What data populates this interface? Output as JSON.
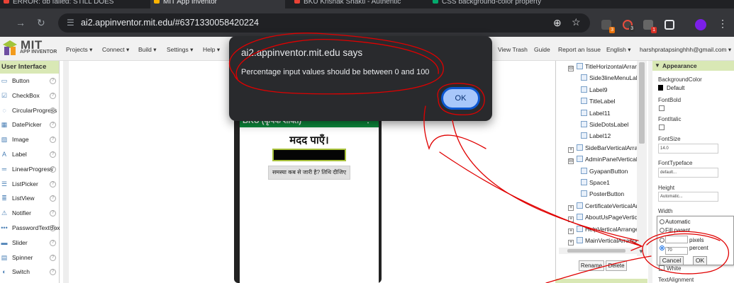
{
  "browser": {
    "tabs": [
      {
        "label": "ERROR: db failed:  STILL DOES",
        "color": "#e94235"
      },
      {
        "label": "MIT App Inventor",
        "color": "#ffb300"
      },
      {
        "label": "BKU Krishak Shakti - Authentic",
        "color": "#e94235"
      },
      {
        "label": "CSS background-color property",
        "color": "#04aa6d"
      }
    ],
    "url": "ai2.appinventor.mit.edu/#6371330058420224",
    "extensions": [
      {
        "name": "puzzle-ext-icon",
        "badge": "3",
        "color": "#ffffff"
      },
      {
        "name": "c-ext-icon",
        "badge": "3",
        "color": "#e84c3d"
      },
      {
        "name": "screen-ext-icon",
        "badge": "1",
        "color": "#bdbdbd"
      },
      {
        "name": "puzzle-piece-icon",
        "badge": "",
        "color": "#e8eaed"
      }
    ]
  },
  "ai_header": {
    "logo_main": "MIT",
    "logo_sub": "APP INVENTOR",
    "menus": [
      "Projects ▾",
      "Connect ▾",
      "Build ▾",
      "Settings ▾",
      "Help ▾"
    ],
    "right_links": [
      "View Trash",
      "Guide",
      "Report an Issue",
      "English ▾",
      "harshpratapsinghhh@gmail.com ▾"
    ]
  },
  "palette": {
    "title": "User Interface",
    "items": [
      {
        "label": "Button",
        "icon": "▭"
      },
      {
        "label": "CheckBox",
        "icon": "☑"
      },
      {
        "label": "CircularProgress",
        "icon": "◌"
      },
      {
        "label": "DatePicker",
        "icon": "▦"
      },
      {
        "label": "Image",
        "icon": "▨"
      },
      {
        "label": "Label",
        "icon": "A"
      },
      {
        "label": "LinearProgress",
        "icon": "═"
      },
      {
        "label": "ListPicker",
        "icon": "☰"
      },
      {
        "label": "ListView",
        "icon": "≣"
      },
      {
        "label": "Notifier",
        "icon": "⚠"
      },
      {
        "label": "PasswordTextBox",
        "icon": "•••"
      },
      {
        "label": "Slider",
        "icon": "▬"
      },
      {
        "label": "Spinner",
        "icon": "▤"
      },
      {
        "label": "Switch",
        "icon": "◐"
      }
    ],
    "help_glyph": "?"
  },
  "phone": {
    "title": "BKU (कृषक शक्ति)",
    "title_menu": "⋮",
    "heading": "मदद पाएँ।",
    "button": "समस्या कब से जारी है? तिथि दीजिए"
  },
  "components": {
    "items": [
      {
        "label": "TitleHorizontalArrang",
        "type": "arrangement",
        "expander": "⊟"
      },
      {
        "label": "Side3lineMenuLab",
        "type": "label",
        "expander": ""
      },
      {
        "label": "Label9",
        "type": "label",
        "expander": ""
      },
      {
        "label": "TitleLabel",
        "type": "label",
        "expander": ""
      },
      {
        "label": "Label11",
        "type": "label",
        "expander": ""
      },
      {
        "label": "SideDotsLabel",
        "type": "label",
        "expander": ""
      },
      {
        "label": "Label12",
        "type": "label",
        "expander": ""
      },
      {
        "label": "SideBarVerticalArrange",
        "type": "arrangement",
        "expander": "+"
      },
      {
        "label": "AdminPanelVertical",
        "type": "arrangement",
        "expander": "⊟"
      },
      {
        "label": "GyapanButton",
        "type": "button",
        "expander": ""
      },
      {
        "label": "Space1",
        "type": "image",
        "expander": ""
      },
      {
        "label": "PosterButton",
        "type": "button",
        "expander": ""
      },
      {
        "label": "CertificateVerticalArra",
        "type": "arrangement",
        "expander": "+"
      },
      {
        "label": "AboutUsPageVertical",
        "type": "arrangement",
        "expander": "+"
      },
      {
        "label": "HelpVerticalArrangem",
        "type": "arrangement",
        "expander": "+"
      },
      {
        "label": "MainVerticalArrange",
        "type": "arrangement",
        "expander": "+"
      }
    ],
    "rename_label": "Rename",
    "delete_label": "Delete"
  },
  "properties": {
    "header": "Appearance",
    "background_color_label": "BackgroundColor",
    "background_color_value": "Default",
    "font_bold_label": "FontBold",
    "font_italic_label": "FontItalic",
    "font_size_label": "FontSize",
    "font_size_value": "14.0",
    "font_typeface_label": "FontTypeface",
    "font_typeface_value": "default...",
    "height_label": "Height",
    "height_value": "Automatic...",
    "width_label": "Width",
    "width_popup": {
      "automatic": "Automatic",
      "fill_parent": "Fill parent",
      "pixels": "pixels",
      "percent_value": "70",
      "percent": "percent",
      "cancel": "Cancel",
      "ok": "OK"
    },
    "text_color_label": "White",
    "text_alignment_label": "TextAlignment"
  },
  "dialog": {
    "title": "ai2.appinventor.mit.edu says",
    "message": "Percentage input values should be between 0 and 100",
    "ok_label": "OK"
  },
  "colors": {
    "browser_dark": "#202124",
    "palette_header": "#d9e8b5",
    "phone_titlebar": "#0c8a3c",
    "annotation_red": "#e00000",
    "dialog_ok": "#a8c7fa"
  }
}
